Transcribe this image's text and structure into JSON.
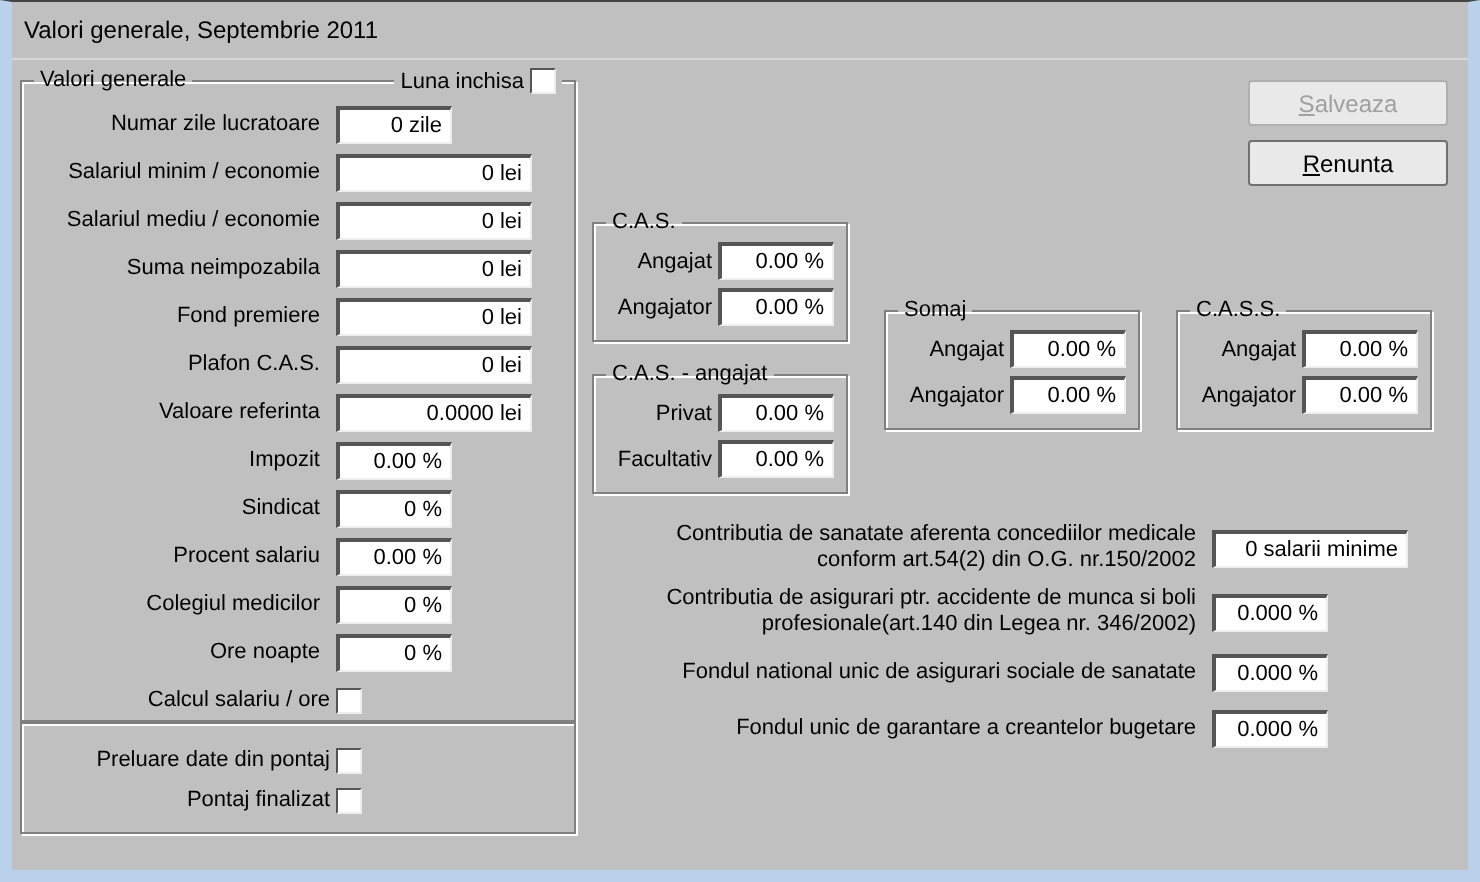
{
  "window": {
    "title": "Valori generale, Septembrie 2011"
  },
  "general_group": {
    "title": "Valori generale",
    "closed_month": {
      "label": "Luna inchisa",
      "checked": false
    },
    "fields": [
      {
        "label": "Numar zile lucratoare",
        "value": "0 zile",
        "kind": "narrow"
      },
      {
        "label": "Salariul minim / economie",
        "value": "0 lei",
        "kind": "wide"
      },
      {
        "label": "Salariul mediu / economie",
        "value": "0 lei",
        "kind": "wide"
      },
      {
        "label": "Suma neimpozabila",
        "value": "0 lei",
        "kind": "wide"
      },
      {
        "label": "Fond premiere",
        "value": "0 lei",
        "kind": "wide"
      },
      {
        "label": "Plafon C.A.S.",
        "value": "0 lei",
        "kind": "wide"
      },
      {
        "label": "Valoare referinta",
        "value": "0.0000 lei",
        "kind": "wide"
      },
      {
        "label": "Impozit",
        "value": "0.00 %",
        "kind": "narrow"
      },
      {
        "label": "Sindicat",
        "value": "0 %",
        "kind": "narrow"
      },
      {
        "label": "Procent salariu",
        "value": "0.00 %",
        "kind": "narrow"
      },
      {
        "label": "Colegiul medicilor",
        "value": "0 %",
        "kind": "narrow"
      },
      {
        "label": "Ore noapte",
        "value": "0 %",
        "kind": "narrow"
      }
    ],
    "hourly": {
      "label": "Calcul salariu / ore",
      "checked": false
    }
  },
  "timesheet_group": {
    "checkboxes": [
      {
        "label": "Preluare date din pontaj",
        "checked": false
      },
      {
        "label": "Pontaj finalizat",
        "checked": false
      }
    ]
  },
  "buttons": [
    {
      "label": "Salveaza",
      "disabled": true
    },
    {
      "label": "Renunta",
      "disabled": false
    }
  ],
  "groups": [
    {
      "title": "C.A.S.",
      "fields": [
        {
          "label": "Angajat",
          "value": "0.00 %"
        },
        {
          "label": "Angajator",
          "value": "0.00 %"
        }
      ]
    },
    {
      "title": "C.A.S. - angajat",
      "fields": [
        {
          "label": "Privat",
          "value": "0.00 %"
        },
        {
          "label": "Facultativ",
          "value": "0.00 %"
        }
      ]
    },
    {
      "title": "Somaj",
      "fields": [
        {
          "label": "Angajat",
          "value": "0.00 %"
        },
        {
          "label": "Angajator",
          "value": "0.00 %"
        }
      ]
    },
    {
      "title": "C.A.S.S.",
      "fields": [
        {
          "label": "Angajat",
          "value": "0.00 %"
        },
        {
          "label": "Angajator",
          "value": "0.00 %"
        }
      ]
    }
  ],
  "contributions": [
    {
      "label": "Contributia de sanatate aferenta concediilor medicale\nconform art.54(2) din O.G. nr.150/2002",
      "value": "0 salarii minime",
      "kind": "wide"
    },
    {
      "label": "Contributia de asigurari ptr. accidente de munca si boli\nprofesionale(art.140 din Legea nr. 346/2002)",
      "value": "0.000 %",
      "kind": "narrow"
    },
    {
      "label": "Fondul national unic de asigurari sociale de sanatate",
      "value": "0.000 %",
      "kind": "narrow"
    },
    {
      "label": "Fondul unic de garantare a creantelor bugetare",
      "value": "0.000 %",
      "kind": "narrow"
    }
  ]
}
